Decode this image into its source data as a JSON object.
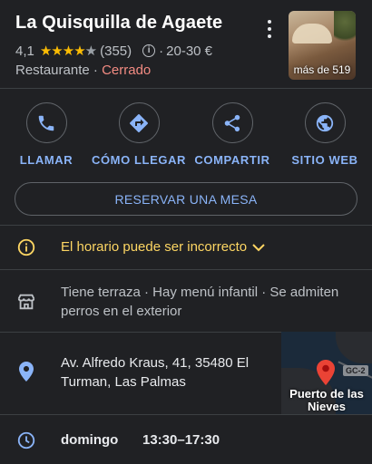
{
  "place": {
    "name": "La Quisquilla de Agaete",
    "rating": "4,1",
    "stars": "★★★★",
    "star_empty": "★",
    "review_count": "(355)",
    "price_sep": "·",
    "price_range": "20-30 €",
    "category": "Restaurante",
    "dot": " · ",
    "status": "Cerrado",
    "photo_caption": "más de 519"
  },
  "actions": [
    {
      "label": "LLAMAR",
      "icon": "phone-icon"
    },
    {
      "label": "CÓMO LLEGAR",
      "icon": "directions-icon"
    },
    {
      "label": "COMPARTIR",
      "icon": "share-icon"
    },
    {
      "label": "SITIO WEB",
      "icon": "globe-icon"
    }
  ],
  "reserve": {
    "label": "RESERVAR UNA MESA"
  },
  "hours_warning": {
    "text": "El horario puede ser incorrecto",
    "icon": "info-icon"
  },
  "amenities": {
    "text": "Tiene terraza · Hay menú infantil · Se admiten perros en el exterior",
    "icon": "storefront-icon"
  },
  "address": {
    "text": "Av. Alfredo Kraus, 41, 35480 El Turman, Las Palmas",
    "icon": "location-pin-icon"
  },
  "map": {
    "road_badge": "GC-2",
    "place_label": "Puerto de las Nieves"
  },
  "hours": {
    "day": "domingo",
    "time": "13:30–17:30",
    "icon": "clock-icon"
  },
  "colors": {
    "background": "#202124",
    "accent": "#8ab4f8",
    "warning": "#fdd663",
    "closed": "#f28b82",
    "star": "#fbbc04"
  }
}
